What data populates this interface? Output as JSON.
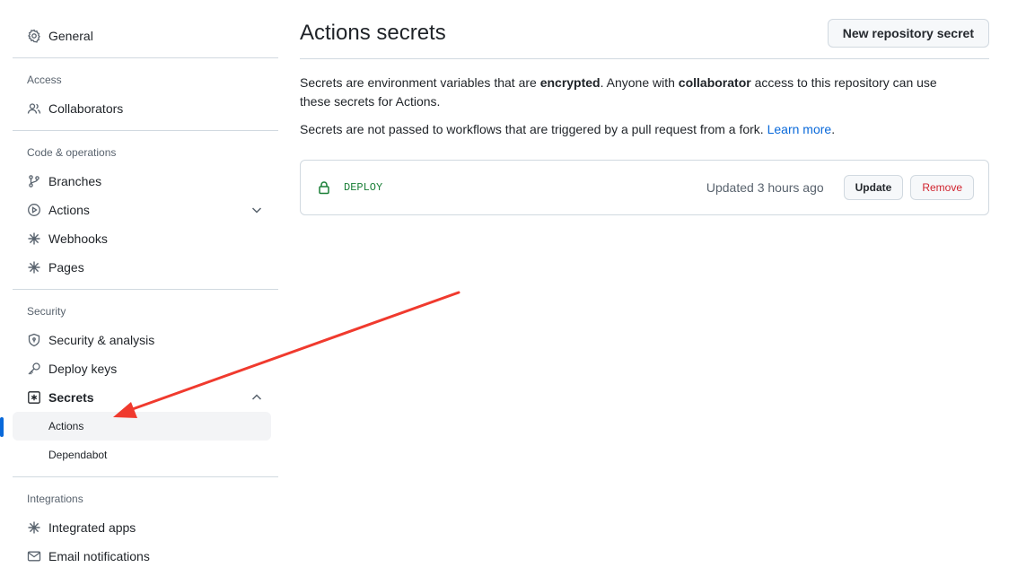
{
  "sidebar": {
    "general": "General",
    "access": {
      "title": "Access",
      "collaborators": "Collaborators"
    },
    "code_ops": {
      "title": "Code & operations",
      "branches": "Branches",
      "actions": "Actions",
      "webhooks": "Webhooks",
      "pages": "Pages"
    },
    "security": {
      "title": "Security",
      "security_analysis": "Security & analysis",
      "deploy_keys": "Deploy keys",
      "secrets": "Secrets",
      "secrets_actions": "Actions",
      "secrets_dependabot": "Dependabot"
    },
    "integrations": {
      "title": "Integrations",
      "integrated_apps": "Integrated apps",
      "email_notifications": "Email notifications"
    }
  },
  "main": {
    "title": "Actions secrets",
    "new_secret_button": "New repository secret",
    "description": {
      "part1": "Secrets are environment variables that are ",
      "bold1": "encrypted",
      "part2": ". Anyone with ",
      "bold2": "collaborator",
      "part3": " access to this repository can use these secrets for Actions."
    },
    "fork_note": "Secrets are not passed to workflows that are triggered by a pull request from a fork.",
    "learn_more": "Learn more",
    "period": ".",
    "secrets": [
      {
        "name": "DEPLOY",
        "updated": "Updated 3 hours ago",
        "update_label": "Update",
        "remove_label": "Remove"
      }
    ]
  },
  "colors": {
    "accent_blue": "#0969da",
    "secret_green": "#1a7f37",
    "danger_red": "#d1242f",
    "annotation_arrow": "#f03a2e"
  }
}
